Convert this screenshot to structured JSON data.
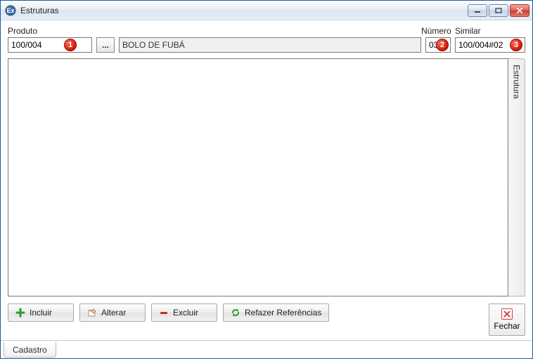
{
  "window": {
    "title": "Estruturas"
  },
  "labels": {
    "produto": "Produto",
    "numero": "Número",
    "similar": "Similar"
  },
  "fields": {
    "produto_code": "100/004",
    "browse": "...",
    "produto_desc": "BOLO DE FUBÁ",
    "numero": "03",
    "similar": "100/004#02"
  },
  "annotations": {
    "a1": "1",
    "a2": "2",
    "a3": "3"
  },
  "side_tab": "Estrutura",
  "toolbar": {
    "incluir": "Incluir",
    "alterar": "Alterar",
    "excluir": "Excluir",
    "refazer": "Refazer Referências",
    "fechar": "Fechar"
  },
  "bottom_tab": "Cadastro",
  "win_controls": {
    "minimize": "—",
    "maximize": "▢",
    "close": "✕"
  },
  "icons": {
    "plus_color": "#2e9b2e",
    "minus_color": "#cc2a2a",
    "refresh_color": "#2e9b2e"
  }
}
